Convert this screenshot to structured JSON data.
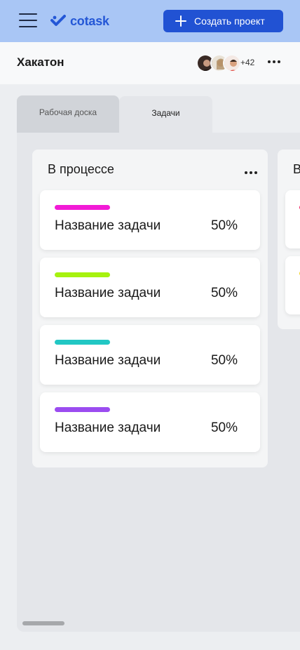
{
  "topbar": {
    "menu_icon": "hamburger-icon",
    "logo_text": "cotask",
    "create_button_label": "Создать проект",
    "create_icon": "plus-icon"
  },
  "project": {
    "title": "Хакатон",
    "members_extra": "+42",
    "more_icon": "more-horizontal-icon"
  },
  "tabs": [
    {
      "label": "Рабочая доска",
      "active": false
    },
    {
      "label": "Задачи",
      "active": true
    }
  ],
  "columns": [
    {
      "title": "В процессе",
      "cards": [
        {
          "name": "Название задачи",
          "progress": "50%",
          "color": "#f21bd6"
        },
        {
          "name": "Название задачи",
          "progress": "50%",
          "color": "#a6f20f"
        },
        {
          "name": "Название задачи",
          "progress": "50%",
          "color": "#22c7c4"
        },
        {
          "name": "Название задачи",
          "progress": "50%",
          "color": "#9b4cf0"
        }
      ]
    },
    {
      "title": "В",
      "cards": [
        {
          "color": "#f21b5c"
        },
        {
          "color": "#f2d21b"
        }
      ]
    }
  ],
  "colors": {
    "accent": "#2152d3",
    "topbar_bg": "#a9c6f5"
  }
}
